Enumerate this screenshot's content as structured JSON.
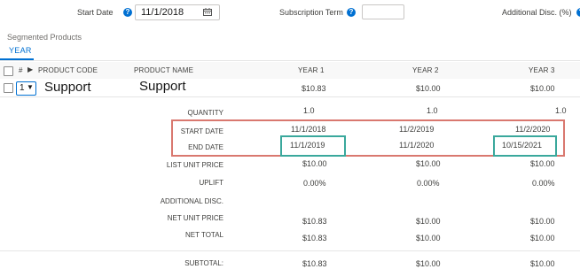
{
  "top_bar": {
    "start_date_label": "Start Date",
    "start_date_value": "11/1/2018",
    "subscription_term_label": "Subscription Term",
    "subscription_term_value": "",
    "additional_disc_label": "Additional Disc. (%)"
  },
  "segments": {
    "title": "Segmented Products",
    "tab": "YEAR"
  },
  "table": {
    "headers": {
      "hash": "#",
      "product_code": "PRODUCT CODE",
      "product_name": "PRODUCT NAME",
      "year1": "YEAR 1",
      "year2": "YEAR 2",
      "year3": "YEAR 3"
    },
    "row": {
      "number": "1",
      "product_code": "Support",
      "product_name": "Support",
      "year1": "$10.83",
      "year2": "$10.00",
      "year3": "$10.00"
    },
    "details": [
      {
        "label": "QUANTITY",
        "y1": "1.0",
        "y2": "1.0",
        "y3": "1.0"
      },
      {
        "label": "START DATE",
        "y1": "11/1/2018",
        "y2": "11/2/2019",
        "y3": "11/2/2020"
      },
      {
        "label": "END DATE",
        "y1": "11/1/2019",
        "y2": "11/1/2020",
        "y3": "10/15/2021"
      },
      {
        "label": "LIST UNIT PRICE",
        "y1": "$10.00",
        "y2": "$10.00",
        "y3": "$10.00"
      },
      {
        "label": "UPLIFT",
        "y1": "0.00%",
        "y2": "0.00%",
        "y3": "0.00%"
      },
      {
        "label": "ADDITIONAL DISC.",
        "y1": "",
        "y2": "",
        "y3": ""
      },
      {
        "label": "NET UNIT PRICE",
        "y1": "$10.83",
        "y2": "$10.00",
        "y3": "$10.00"
      },
      {
        "label": "NET TOTAL",
        "y1": "$10.83",
        "y2": "$10.00",
        "y3": "$10.00"
      }
    ],
    "subtotal": {
      "label": "SUBTOTAL:",
      "y1": "$10.83",
      "y2": "$10.00",
      "y3": "$10.00"
    }
  },
  "colors": {
    "accent": "#0070d2",
    "highlight_red": "#d9786f",
    "highlight_green": "#3aa89c"
  },
  "icons": {
    "help": "help-icon",
    "calendar": "calendar-icon",
    "expand": "expand-arrow-icon",
    "dropdown": "chevron-down-icon"
  }
}
